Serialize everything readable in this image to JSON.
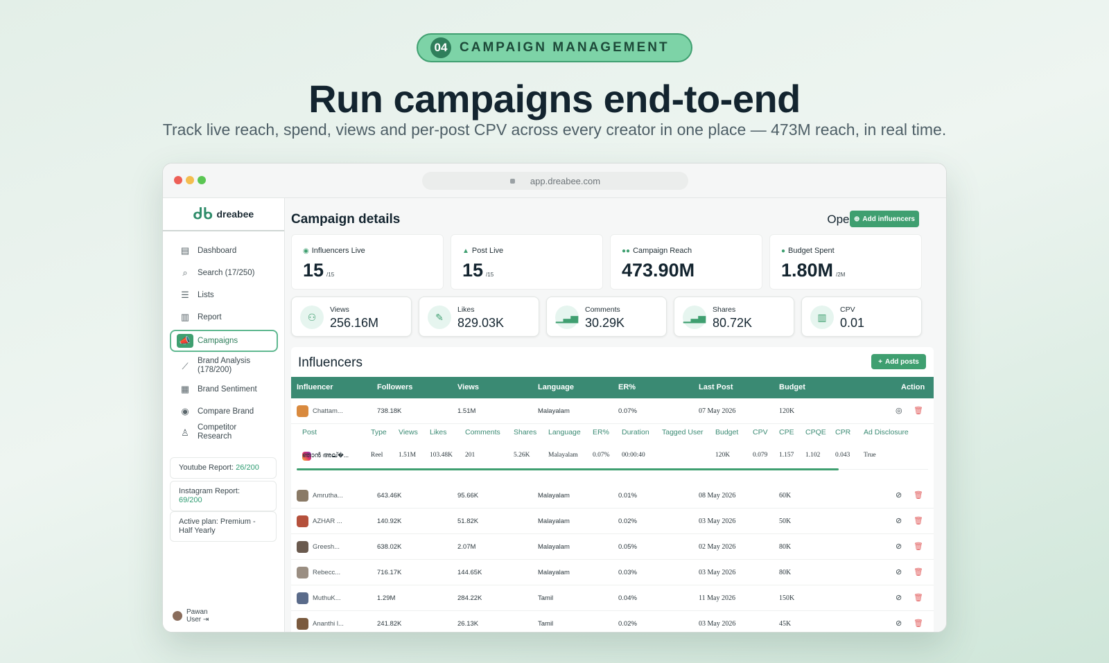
{
  "badge": {
    "number": "04",
    "text": "CAMPAIGN MANAGEMENT"
  },
  "hero": {
    "title": "Run campaigns end-to-end",
    "subtitle": "Track live reach, spend, views and per-post CPV across every creator in one place — 473M reach, in real time."
  },
  "browser": {
    "url": "app.dreabee.com"
  },
  "sidebar": {
    "logo": "dreabee",
    "items": [
      {
        "label": "Dashboard",
        "icon": "dashboard-icon"
      },
      {
        "label": "Search (17/250)",
        "icon": "search-icon"
      },
      {
        "label": "Lists",
        "icon": "list-icon"
      },
      {
        "label": "Report",
        "icon": "report-icon"
      },
      {
        "label": "Campaigns",
        "icon": "megaphone-icon"
      },
      {
        "label": "Brand Analysis (178/200)",
        "icon": "chart-line-icon"
      },
      {
        "label": "Brand Sentiment",
        "icon": "sentiment-icon"
      },
      {
        "label": "Compare Brand",
        "icon": "compare-icon"
      },
      {
        "label": "Competitor Research",
        "icon": "research-icon"
      }
    ],
    "youtube_report": {
      "label": "Youtube Report:",
      "value": "26/200"
    },
    "instagram_report": {
      "label": "Instagram Report:",
      "value": "69/200"
    },
    "plan": "Active plan: Premium - Half Yearly",
    "user": {
      "first": "Pawan",
      "last": "User"
    }
  },
  "main": {
    "title": "Campaign details",
    "brand": "OpenAI",
    "add_influencers": "Add influencers",
    "stats": [
      {
        "label": "Influencers Live",
        "value": "15",
        "suffix": "/15"
      },
      {
        "label": "Post Live",
        "value": "15",
        "suffix": "/15"
      },
      {
        "label": "Campaign Reach",
        "value": "473.90M",
        "suffix": ""
      },
      {
        "label": "Budget Spent",
        "value": "1.80M",
        "suffix": "/2M"
      }
    ],
    "metrics": [
      {
        "label": "Views",
        "value": "256.16M"
      },
      {
        "label": "Likes",
        "value": "829.03K"
      },
      {
        "label": "Comments",
        "value": "30.29K"
      },
      {
        "label": "Shares",
        "value": "80.72K"
      },
      {
        "label": "CPV",
        "value": "0.01"
      }
    ],
    "influencers": {
      "title": "Influencers",
      "add_posts": "Add posts",
      "columns": [
        "Influencer",
        "Followers",
        "Views",
        "Language",
        "ER%",
        "Last Post",
        "Budget",
        "Action"
      ],
      "rows": [
        {
          "name": "Chattam...",
          "followers": "738.18K",
          "views": "1.51M",
          "language": "Malayalam",
          "er": "0.07%",
          "last_post": "07 May 2026",
          "budget": "120K"
        },
        {
          "name": "Amrutha...",
          "followers": "643.46K",
          "views": "95.66K",
          "language": "Malayalam",
          "er": "0.01%",
          "last_post": "08 May 2026",
          "budget": "60K"
        },
        {
          "name": "AZHAR ...",
          "followers": "140.92K",
          "views": "51.82K",
          "language": "Malayalam",
          "er": "0.02%",
          "last_post": "03 May 2026",
          "budget": "50K"
        },
        {
          "name": "Greesh...",
          "followers": "638.02K",
          "views": "2.07M",
          "language": "Malayalam",
          "er": "0.05%",
          "last_post": "02 May 2026",
          "budget": "80K"
        },
        {
          "name": "Rebecc...",
          "followers": "716.17K",
          "views": "144.65K",
          "language": "Malayalam",
          "er": "0.03%",
          "last_post": "03 May 2026",
          "budget": "80K"
        },
        {
          "name": "MuthuK...",
          "followers": "1.29M",
          "views": "284.22K",
          "language": "Tamil",
          "er": "0.04%",
          "last_post": "11 May 2026",
          "budget": "150K"
        },
        {
          "name": "Ananthi l...",
          "followers": "241.82K",
          "views": "26.13K",
          "language": "Tamil",
          "er": "0.02%",
          "last_post": "03 May 2026",
          "budget": "45K"
        }
      ],
      "post_columns": [
        "Post",
        "Type",
        "Views",
        "Likes",
        "Comments",
        "Shares",
        "Language",
        "ER%",
        "Duration",
        "Tagged User",
        "Budget",
        "CPV",
        "CPE",
        "CPQE",
        "CPR",
        "Ad Disclosure"
      ],
      "post_row": [
        "ഞാൻ അല്�...",
        "Reel",
        "1.51M",
        "103.48K",
        "201",
        "5.26K",
        "Malayalam",
        "0.07%",
        "00:00:40",
        "",
        "120K",
        "0.079",
        "1.157",
        "1.102",
        "0.043",
        "True"
      ]
    }
  }
}
